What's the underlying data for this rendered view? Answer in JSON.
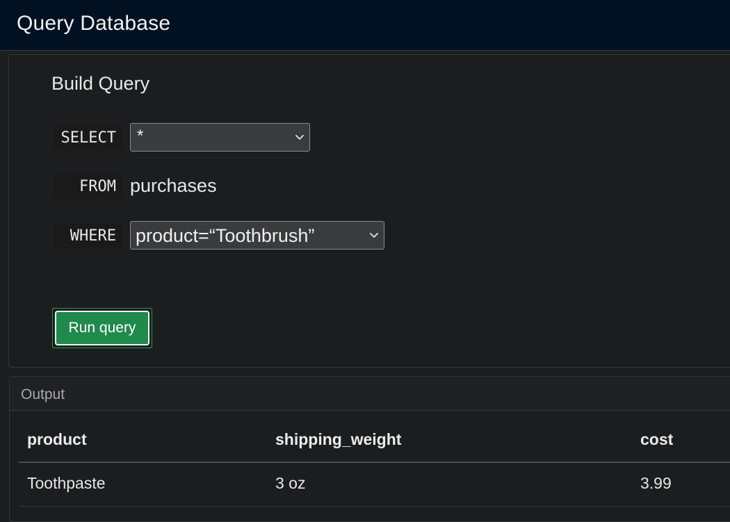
{
  "header": {
    "title": "Query Database"
  },
  "builder": {
    "title": "Build Query",
    "select_keyword": "SELECT",
    "select_value": "*",
    "from_keyword": "FROM",
    "from_value": "purchases",
    "where_keyword": "WHERE",
    "where_value": "product=“Toothbrush”",
    "run_label": "Run query"
  },
  "output": {
    "title": "Output",
    "columns": [
      "product",
      "shipping_weight",
      "cost"
    ],
    "rows": [
      [
        "Toothpaste",
        "3 oz",
        "3.99"
      ]
    ]
  },
  "colors": {
    "topbar_bg": "#021121",
    "panel_bg": "#1c1d1f",
    "run_button": "#1f8a4c"
  },
  "icons": {
    "select_chevron": "chevron-down-icon",
    "where_chevron": "chevron-down-icon"
  }
}
